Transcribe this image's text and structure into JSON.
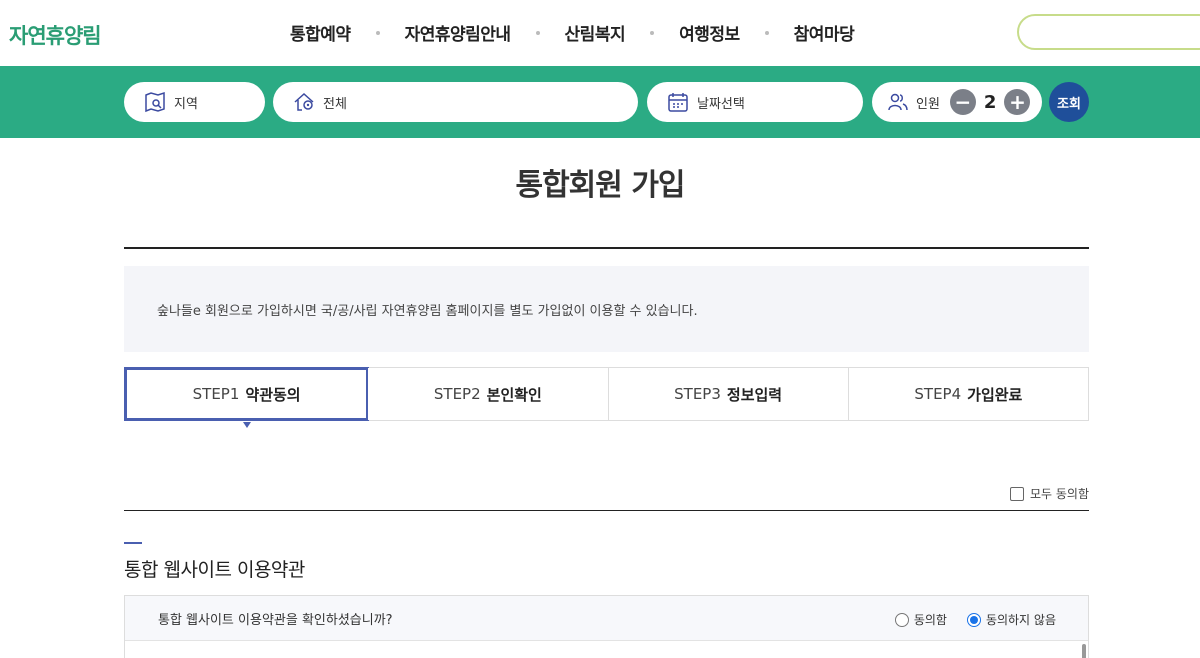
{
  "header": {
    "logo": "자연휴양림",
    "nav": [
      "통합예약",
      "자연휴양림안내",
      "산림복지",
      "여행정보",
      "참여마당"
    ],
    "search_placeholder": ""
  },
  "searchbar": {
    "region_label": "지역",
    "area_label": "전체",
    "date_label": "날짜선택",
    "people_label": "인원",
    "people_count": "2",
    "minus": "−",
    "plus": "+",
    "submit_label": "조회"
  },
  "main": {
    "title": "통합회원 가입",
    "info_text": "숲나들e 회원으로 가입하시면 국/공/사립 자연휴양림 홈페이지를 별도 가입없이 이용할 수 있습니다.",
    "steps": [
      {
        "num": "STEP1",
        "name": "약관동의"
      },
      {
        "num": "STEP2",
        "name": "본인확인"
      },
      {
        "num": "STEP3",
        "name": "정보입력"
      },
      {
        "num": "STEP4",
        "name": "가입완료"
      }
    ],
    "agree_all": "모두 동의함",
    "section_title": "통합 웹사이트 이용약관",
    "terms_question": "통합 웹사이트 이용약관을 확인하셨습니까?",
    "radio_agree": "동의함",
    "radio_disagree": "동의하지 않음"
  },
  "colors": {
    "brand_green": "#2bab84",
    "logo_green": "#2a9d74",
    "accent_blue": "#4a5fb0",
    "submit_navy": "#1f4f9a"
  }
}
